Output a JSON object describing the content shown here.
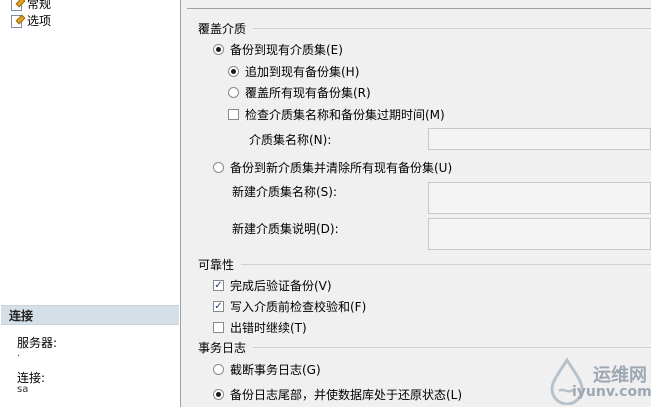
{
  "nav": {
    "items": [
      {
        "label": "常规"
      },
      {
        "label": "选项"
      }
    ]
  },
  "connection": {
    "header": "连接",
    "server_label": "服务器:",
    "server_value": ".",
    "connection_label": "连接:",
    "connection_value": "sa"
  },
  "media": {
    "title": "覆盖介质",
    "backup_existing": "备份到现有介质集(E)",
    "append": "追加到现有备份集(H)",
    "overwrite": "覆盖所有现有备份集(R)",
    "check_expiry": "检查介质集名称和备份集过期时间(M)",
    "media_name_label": "介质集名称(N):",
    "backup_new": "备份到新介质集并清除所有现有备份集(U)",
    "new_media_name_label": "新建介质集名称(S):",
    "new_media_desc_label": "新建介质集说明(D):"
  },
  "reliability": {
    "title": "可靠性",
    "verify": "完成后验证备份(V)",
    "checksum": "写入介质前检查校验和(F)",
    "continue_on_error": "出错时继续(T)"
  },
  "txlog": {
    "title": "事务日志",
    "truncate": "截断事务日志(G)",
    "tail": "备份日志尾部，并使数据库处于还原状态(L)"
  },
  "watermark": {
    "line1": "运维网",
    "line2": "iyunv.com"
  }
}
